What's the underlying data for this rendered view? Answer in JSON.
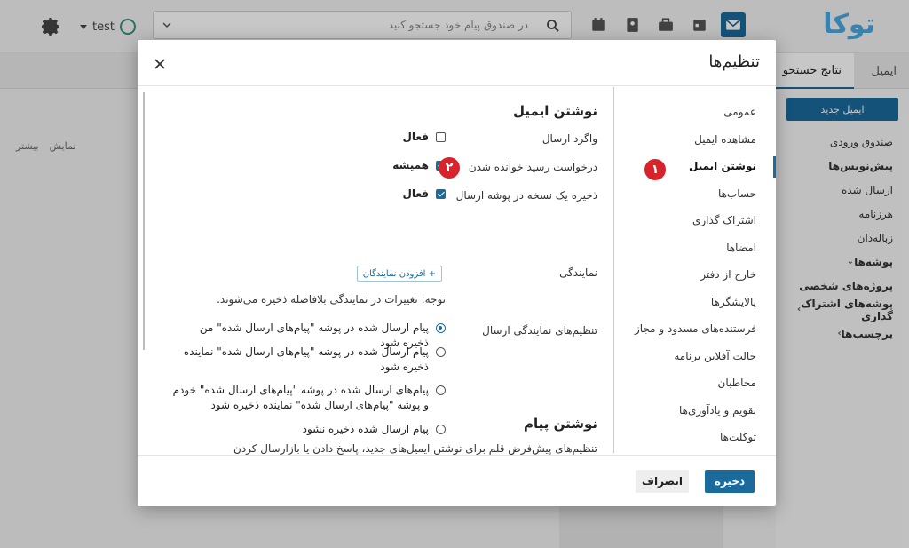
{
  "app": {
    "logo_text": "توکا",
    "search_placeholder": "در صندوق پیام خود جستجو کنید",
    "user_name": "test",
    "tabs": [
      "ایمیل",
      "نتایج جستجو"
    ],
    "new_mail_label": "ایمیل جدید",
    "folders": [
      "صندوق ورودی",
      "پیش‌نویس‌ها",
      "ارسال شده",
      "هرزنامه",
      "زباله‌دان",
      "پوشه‌ها",
      "پروژه‌های شخصی",
      "پوشه‌های اشتراک گذاری",
      "برچسب‌ها"
    ],
    "view_label": "نمایش",
    "more_label": "بیشتر"
  },
  "modal": {
    "title": "تنظیم‌ها",
    "nav_items": [
      "عمومی",
      "مشاهده ایمیل",
      "نوشتن ایمیل",
      "حساب‌ها",
      "اشتراک گذاری",
      "امضاها",
      "خارج از دفتر",
      "پالایشگرها",
      "فرستنده‌های مسدود و مجاز",
      "حالت آفلاین برنامه",
      "مخاطبان",
      "تقویم و یادآوری‌ها",
      "توکلت‌ها"
    ],
    "active_nav": "نوشتن ایمیل",
    "compose": {
      "title": "نوشتن ایمیل",
      "undo_send_label": "واگرد ارسال",
      "undo_send_value": "فعال",
      "read_receipt_label": "درخواست رسید خوانده شدن",
      "read_receipt_value": "همیشه",
      "save_copy_label": "ذخیره یک نسخه در پوشه ارسال",
      "save_copy_value": "فعال",
      "delegate_label": "نمایندگی",
      "add_delegate_label": "+ افزودن نمایندگان",
      "note": "توجه: تغییرات در نمایندگی بلافاصله ذخیره می‌شوند.",
      "delegate_send_label": "تنظیم‌های نمایندگی ارسال",
      "radio_options": [
        "پیام ارسال شده در پوشه \"پیام‌های ارسال شده\" من ذخیره شود",
        "پیام ارسال شده در پوشه \"پیام‌های ارسال شده\" نماینده ذخیره شود",
        "پیام‌های ارسال شده در پوشه \"پیام‌های ارسال شده\" خودم و پوشه \"پیام‌های ارسال شده\" نماینده ذخیره شود",
        "پیام ارسال شده ذخیره نشود"
      ]
    },
    "message": {
      "title": "نوشتن پیام",
      "description": "تنظیم‌های پیش‌فرض قلم برای نوشتن ایمیل‌های جدید، پاسخ دادن یا بازارسال کردن ایمیل"
    },
    "badges": [
      "۱",
      "۲"
    ],
    "save_label": "ذخیره",
    "cancel_label": "انصراف"
  },
  "colors": {
    "accent": "#1b6a9c",
    "badge": "#d8232a"
  }
}
